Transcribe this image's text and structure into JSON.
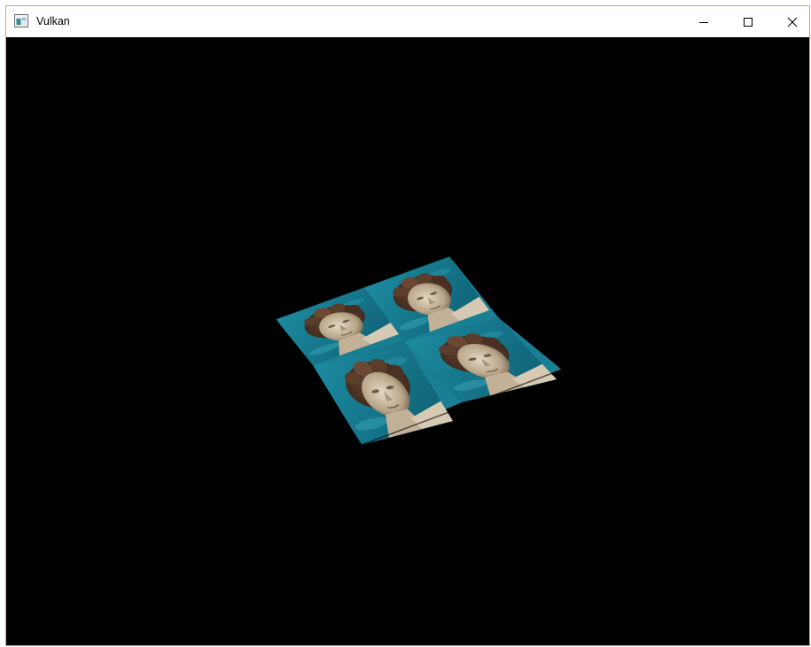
{
  "window": {
    "title": "Vulkan",
    "icon": "app-window-icon",
    "controls": [
      "minimize-icon",
      "maximize-icon",
      "close-icon"
    ]
  },
  "scene": {
    "description_colors": {
      "background": "#000000",
      "sky": "#1b7e93",
      "statue": "#c9bba3"
    },
    "tiles": 4
  }
}
